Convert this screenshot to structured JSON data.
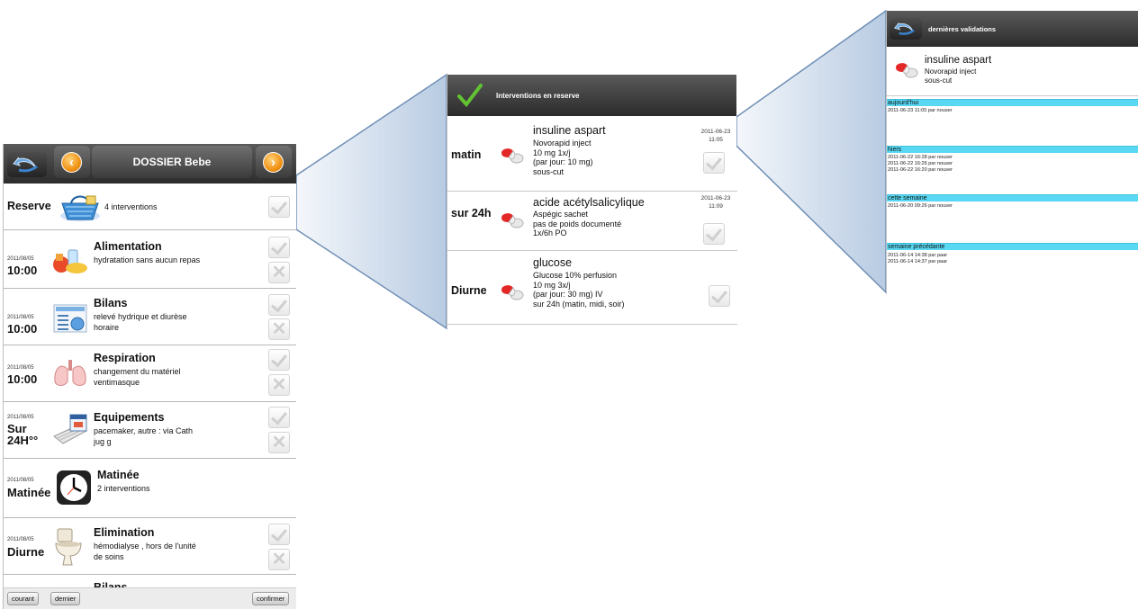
{
  "panel1": {
    "title": "DOSSIER Bebe",
    "reserve": {
      "label": "Reserve",
      "count": "4 interventions"
    },
    "rows": [
      {
        "date": "2011/08/05",
        "time": "10:00",
        "title": "Alimentation",
        "desc": "hydratation sans aucun repas",
        "icon": "food-icon"
      },
      {
        "date": "2011/08/05",
        "time": "10:00",
        "title": "Bilans",
        "desc": "relevé hydrique et diurèse horaire",
        "icon": "chart-document-icon"
      },
      {
        "date": "2011/08/05",
        "time": "10:00",
        "title": "Respiration",
        "desc": "changement du matériel ventimasque",
        "icon": "lungs-icon"
      },
      {
        "date": "2011/08/05",
        "time": "Sur 24H°°",
        "title": "Equipements",
        "desc": "pacemaker, autre : via Cath jug g",
        "icon": "equipment-box-icon"
      },
      {
        "date": "2011/08/05",
        "time": "Matinée",
        "title": "Matinée",
        "desc": "2 interventions",
        "icon": "clock-icon"
      },
      {
        "date": "2011/08/05",
        "time": "Diurne",
        "title": "Elimination",
        "desc": "hémodialyse , hors de l'unité de soins",
        "icon": "toilet-icon"
      },
      {
        "date": "",
        "time": "",
        "title": "Bilans",
        "desc": "",
        "icon": ""
      }
    ],
    "footer": {
      "courant": "courant",
      "dernier": "dernier",
      "confirmer": "confirmer"
    }
  },
  "panel2": {
    "title": "Interventions en reserve",
    "items": [
      {
        "period": "matin",
        "name": "insuline aspart",
        "lines": [
          "Novorapid inject",
          "10 mg 1x/j",
          "(par jour: 10 mg)",
          "sous-cut"
        ],
        "date": "2011-06-23",
        "time": "11:05"
      },
      {
        "period": "sur 24h",
        "name": "acide acétylsalicylique",
        "lines": [
          "Aspégic sachet",
          "pas de poids documenté",
          "1x/6h PO"
        ],
        "date": "2011-06-23",
        "time": "11:09"
      },
      {
        "period": "Diurne",
        "name": "glucose",
        "lines": [
          "Glucose 10% perfusion",
          "10 mg 3x/j",
          "(par jour: 30 mg)  IV",
          "sur 24h (matin, midi, soir)"
        ],
        "date": "",
        "time": ""
      }
    ]
  },
  "panel3": {
    "title": "dernières validations",
    "drug": {
      "name": "insuline aspart",
      "line1": "Novorapid inject",
      "line2": "sous-cut"
    },
    "groups": [
      {
        "label": "aujourd'hui",
        "entries": [
          "2011-06-23 11:05 par nouser"
        ]
      },
      {
        "label": "hiers",
        "entries": [
          "2011-06-22 16:28 par nouser",
          "2011-06-22 16:26 par nouser",
          "2011-06-22 16:20 par nouser"
        ]
      },
      {
        "label": "cette semaine",
        "entries": [
          "2011-06-20 09:26 par nouser"
        ]
      },
      {
        "label": "semaine précédante",
        "entries": [
          "2011-06-14 14:38 par paar",
          "2011-06-14 14:37 par paar"
        ]
      }
    ]
  },
  "colors": {
    "header_dark": "#2c2c2c",
    "accent_cyan": "#58d8f2",
    "orange_nav": "#f09316",
    "check_green": "#5cb82e",
    "cone_fill": "#c9d8ea"
  }
}
